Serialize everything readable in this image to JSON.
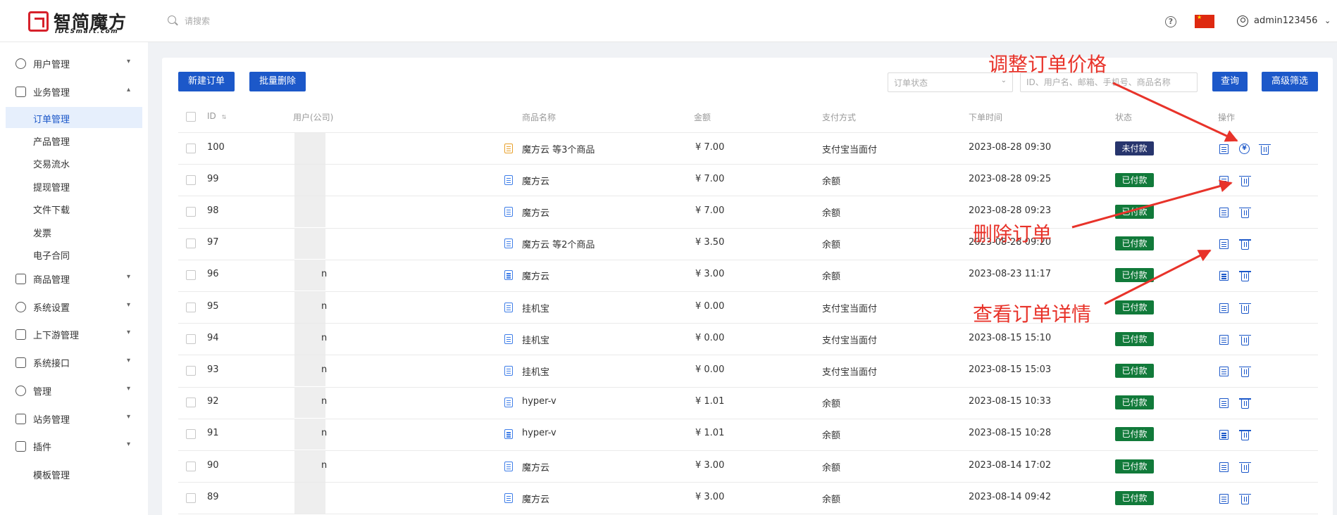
{
  "app": {
    "logo_title": "智简魔方",
    "logo_subtitle": "IDCSmart.com",
    "search_placeholder": "请搜索",
    "language_flag": "china-flag",
    "username": "admin123456"
  },
  "sidebar": {
    "items": [
      {
        "label": "用户管理",
        "icon": "user-icon",
        "expanded": false
      },
      {
        "label": "业务管理",
        "icon": "document-icon",
        "expanded": true
      },
      {
        "label": "商品管理",
        "icon": "cart-icon",
        "expanded": false
      },
      {
        "label": "系统设置",
        "icon": "gear-icon",
        "expanded": false
      },
      {
        "label": "上下游管理",
        "icon": "funnel-icon",
        "expanded": false
      },
      {
        "label": "系统接口",
        "icon": "folder-icon",
        "expanded": false
      },
      {
        "label": "管理",
        "icon": "asterisk-icon",
        "expanded": false
      },
      {
        "label": "站务管理",
        "icon": "site-icon",
        "expanded": false
      },
      {
        "label": "插件",
        "icon": "cube-icon",
        "expanded": false
      }
    ],
    "business_sub": [
      {
        "label": "订单管理",
        "active": true
      },
      {
        "label": "产品管理"
      },
      {
        "label": "交易流水"
      },
      {
        "label": "提现管理"
      },
      {
        "label": "文件下载"
      },
      {
        "label": "发票"
      },
      {
        "label": "电子合同"
      }
    ],
    "plugin_sub": [
      {
        "label": "模板管理"
      }
    ]
  },
  "toolbar": {
    "new_order": "新建订单",
    "batch_delete": "批量删除",
    "status_placeholder": "订单状态",
    "filter_placeholder": "ID、用户名、邮箱、手机号、商品名称",
    "query": "查询",
    "advanced": "高级筛选"
  },
  "table": {
    "headers": {
      "id": "ID",
      "user": "用户(公司)",
      "product": "商品名称",
      "amount": "金额",
      "payment": "支付方式",
      "time": "下单时间",
      "status": "状态",
      "actions": "操作"
    },
    "rows": [
      {
        "id": "100",
        "user": "",
        "product": "魔方云 等3个商品",
        "amount": "¥ 7.00",
        "payment": "支付宝当面付",
        "time": "2023-08-28 09:30",
        "status": "未付款"
      },
      {
        "id": "99",
        "user": "",
        "product": "魔方云",
        "amount": "¥ 7.00",
        "payment": "余额",
        "time": "2023-08-28 09:25",
        "status": "已付款"
      },
      {
        "id": "98",
        "user": "",
        "product": "魔方云",
        "amount": "¥ 7.00",
        "payment": "余额",
        "time": "2023-08-28 09:23",
        "status": "已付款"
      },
      {
        "id": "97",
        "user": "",
        "product": "魔方云 等2个商品",
        "amount": "¥ 3.50",
        "payment": "余额",
        "time": "2023-08-28 09:20",
        "status": "已付款"
      },
      {
        "id": "96",
        "user": "n",
        "product": "魔方云",
        "amount": "¥ 3.00",
        "payment": "余额",
        "time": "2023-08-23 11:17",
        "status": "已付款"
      },
      {
        "id": "95",
        "user": "n",
        "product": "挂机宝",
        "amount": "¥ 0.00",
        "payment": "支付宝当面付",
        "time": "",
        "status": "已付款"
      },
      {
        "id": "94",
        "user": "n",
        "product": "挂机宝",
        "amount": "¥ 0.00",
        "payment": "支付宝当面付",
        "time": "2023-08-15 15:10",
        "status": "已付款"
      },
      {
        "id": "93",
        "user": "n",
        "product": "挂机宝",
        "amount": "¥ 0.00",
        "payment": "支付宝当面付",
        "time": "2023-08-15 15:03",
        "status": "已付款"
      },
      {
        "id": "92",
        "user": "n",
        "product": "hyper-v",
        "amount": "¥ 1.01",
        "payment": "余额",
        "time": "2023-08-15 10:33",
        "status": "已付款"
      },
      {
        "id": "91",
        "user": "n",
        "product": "hyper-v",
        "amount": "¥ 1.01",
        "payment": "余额",
        "time": "2023-08-15 10:28",
        "status": "已付款"
      },
      {
        "id": "90",
        "user": "n",
        "product": "魔方云",
        "amount": "¥ 3.00",
        "payment": "余额",
        "time": "2023-08-14 17:02",
        "status": "已付款"
      },
      {
        "id": "89",
        "user": "",
        "product": "魔方云",
        "amount": "¥ 3.00",
        "payment": "余额",
        "time": "2023-08-14 09:42",
        "status": "已付款"
      }
    ]
  },
  "annotations": {
    "adjust_price": "调整订单价格",
    "delete_order": "删除订单",
    "view_detail": "查看订单详情"
  },
  "colors": {
    "primary": "#1c58c9",
    "paid": "#117a3a",
    "unpaid": "#27356d",
    "annotation": "#e8332a"
  }
}
